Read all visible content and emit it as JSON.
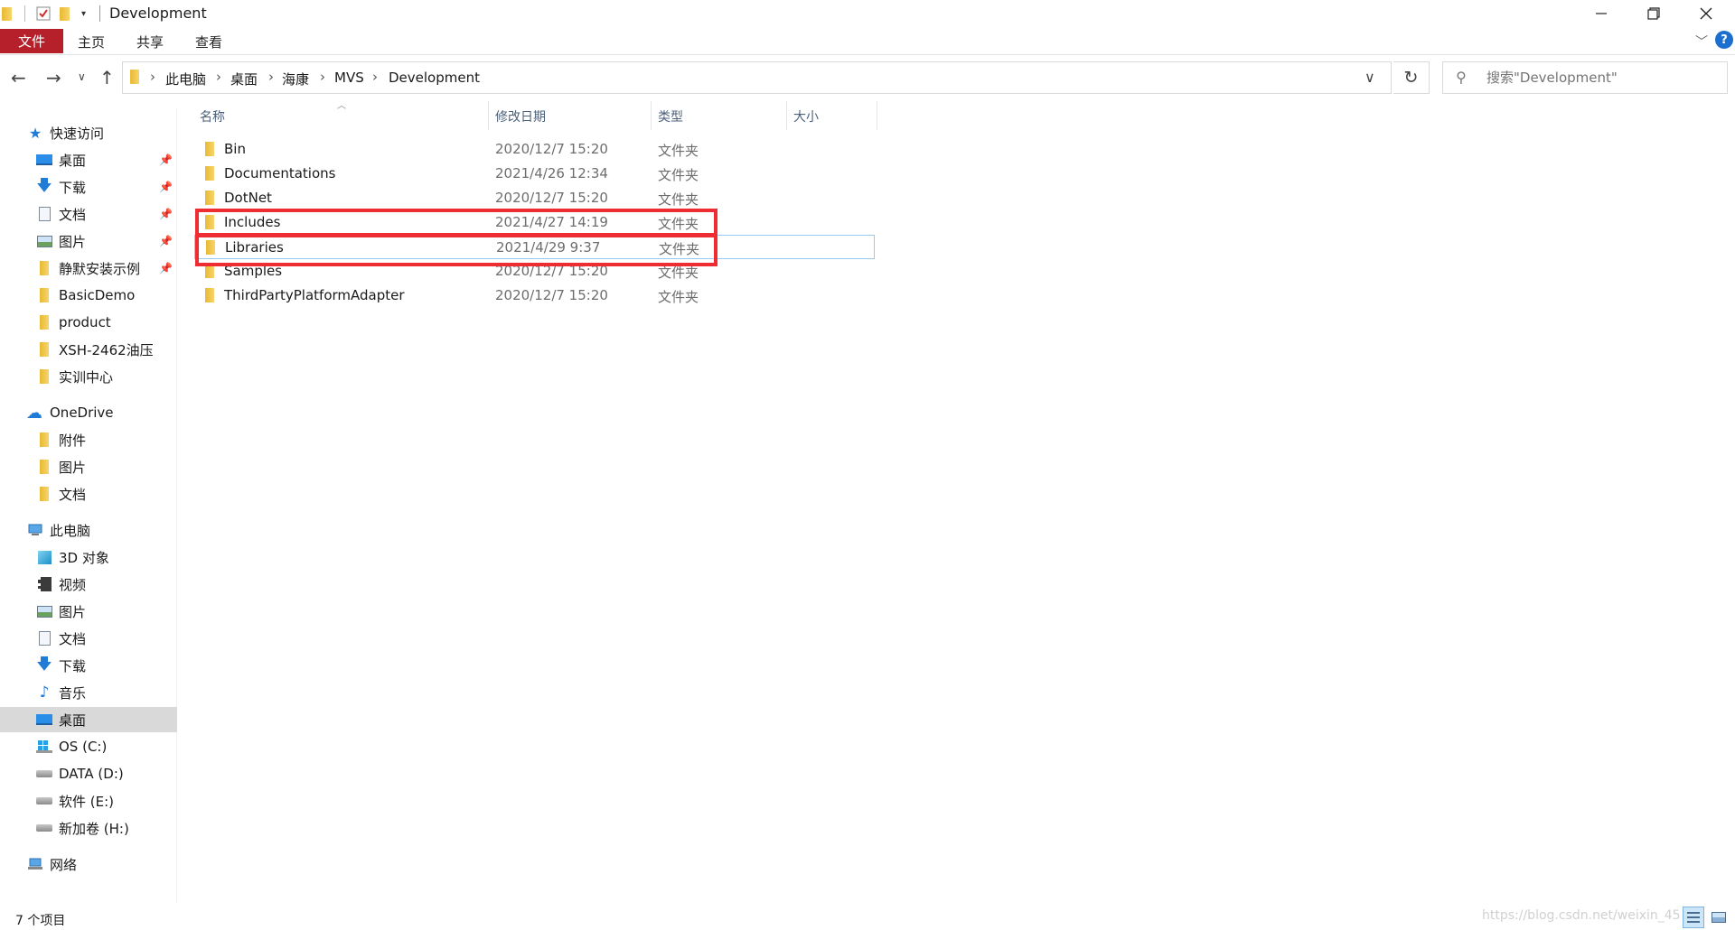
{
  "window": {
    "title": "Development",
    "quick_access_toolbar": [
      "folder-icon",
      "properties-check-icon",
      "new-folder-icon",
      "customize-dropdown-icon"
    ]
  },
  "ribbon": {
    "tabs": [
      {
        "label": "文件",
        "active": true
      },
      {
        "label": "主页"
      },
      {
        "label": "共享"
      },
      {
        "label": "查看"
      }
    ],
    "help_label": "?"
  },
  "navigation": {
    "breadcrumb": [
      "此电脑",
      "桌面",
      "海康",
      "MVS",
      "Development"
    ],
    "search_placeholder": "搜索\"Development\""
  },
  "sidebar": {
    "quick_access": {
      "label": "快速访问",
      "items": [
        {
          "label": "桌面",
          "icon": "desktop-icon",
          "pinned": true
        },
        {
          "label": "下载",
          "icon": "download-icon",
          "pinned": true
        },
        {
          "label": "文档",
          "icon": "document-icon",
          "pinned": true
        },
        {
          "label": "图片",
          "icon": "pictures-icon",
          "pinned": true
        },
        {
          "label": "静默安装示例",
          "icon": "folder-icon",
          "pinned": true
        },
        {
          "label": "BasicDemo",
          "icon": "folder-icon"
        },
        {
          "label": "product",
          "icon": "folder-icon"
        },
        {
          "label": "XSH-2462油压",
          "icon": "folder-icon"
        },
        {
          "label": "实训中心",
          "icon": "folder-icon"
        }
      ]
    },
    "onedrive": {
      "label": "OneDrive",
      "items": [
        {
          "label": "附件",
          "icon": "folder-icon"
        },
        {
          "label": "图片",
          "icon": "folder-icon"
        },
        {
          "label": "文档",
          "icon": "folder-icon"
        }
      ]
    },
    "this_pc": {
      "label": "此电脑",
      "items": [
        {
          "label": "3D 对象",
          "icon": "cube-icon"
        },
        {
          "label": "视频",
          "icon": "video-icon"
        },
        {
          "label": "图片",
          "icon": "pictures-icon"
        },
        {
          "label": "文档",
          "icon": "document-icon"
        },
        {
          "label": "下载",
          "icon": "download-icon"
        },
        {
          "label": "音乐",
          "icon": "music-icon"
        },
        {
          "label": "桌面",
          "icon": "desktop-icon",
          "selected": true
        },
        {
          "label": "OS (C:)",
          "icon": "windows-drive-icon"
        },
        {
          "label": "DATA (D:)",
          "icon": "drive-icon"
        },
        {
          "label": "软件 (E:)",
          "icon": "drive-icon"
        },
        {
          "label": "新加卷 (H:)",
          "icon": "drive-icon"
        }
      ]
    },
    "network": {
      "label": "网络"
    }
  },
  "columns": {
    "name": "名称",
    "modified": "修改日期",
    "type": "类型",
    "size": "大小"
  },
  "files": [
    {
      "name": "Bin",
      "modified": "2020/12/7 15:20",
      "type": "文件夹"
    },
    {
      "name": "Documentations",
      "modified": "2021/4/26 12:34",
      "type": "文件夹"
    },
    {
      "name": "DotNet",
      "modified": "2020/12/7 15:20",
      "type": "文件夹"
    },
    {
      "name": "Includes",
      "modified": "2021/4/27 14:19",
      "type": "文件夹",
      "highlighted": true
    },
    {
      "name": "Libraries",
      "modified": "2021/4/29 9:37",
      "type": "文件夹",
      "highlighted": true,
      "focused": true
    },
    {
      "name": "Samples",
      "modified": "2020/12/7 15:20",
      "type": "文件夹"
    },
    {
      "name": "ThirdPartyPlatformAdapter",
      "modified": "2020/12/7 15:20",
      "type": "文件夹"
    }
  ],
  "status": {
    "item_count": "7 个项目",
    "watermark": "https://blog.csdn.net/weixin_45"
  },
  "colors": {
    "file_tab_bg": "#b5202a",
    "highlight_box": "#ee2d33",
    "selected_sidebar_bg": "#d9d9d9",
    "folder_yellow": "#f0c850"
  }
}
